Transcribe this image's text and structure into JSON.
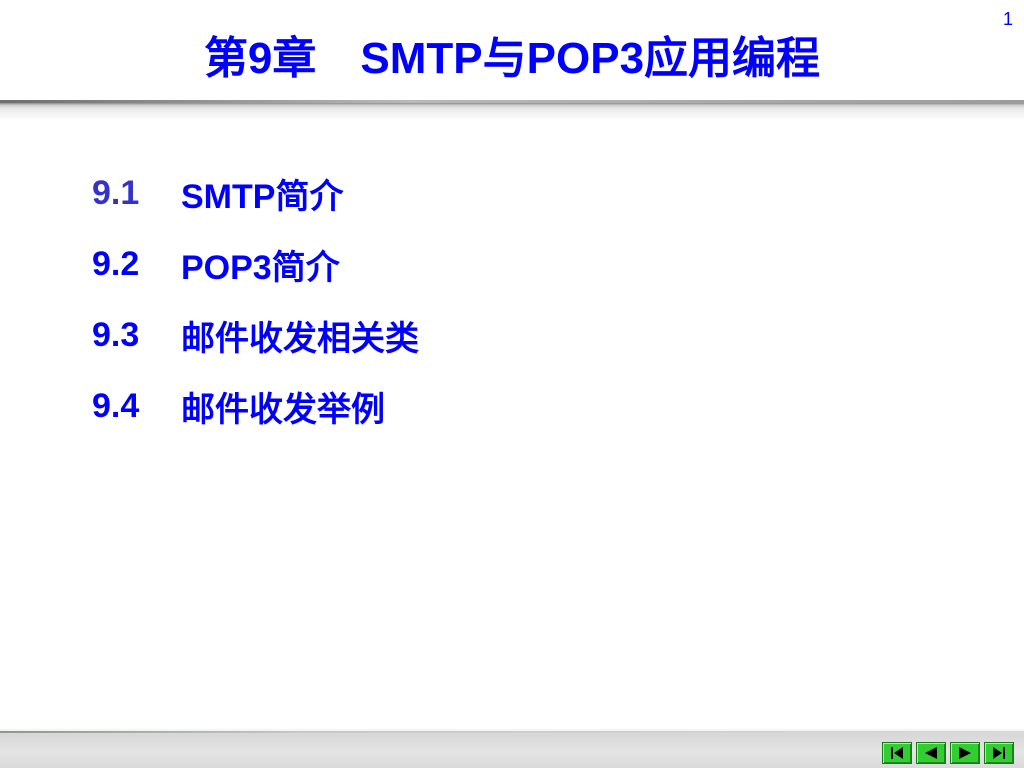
{
  "page_number": "1",
  "title": {
    "chapter": "第9章",
    "subject": "SMTP与POP3应用编程"
  },
  "toc": [
    {
      "number": "9.1",
      "label": "SMTP简介"
    },
    {
      "number": "9.2",
      "label": "POP3简介"
    },
    {
      "number": "9.3",
      "label": "邮件收发相关类"
    },
    {
      "number": "9.4",
      "label": "邮件收发举例"
    }
  ],
  "navigation": [
    {
      "icon": "first-slide-icon"
    },
    {
      "icon": "previous-slide-icon"
    },
    {
      "icon": "next-slide-icon"
    },
    {
      "icon": "last-slide-icon"
    }
  ],
  "colors": {
    "text": "#0000ff",
    "nav_button": "#33cc33"
  }
}
